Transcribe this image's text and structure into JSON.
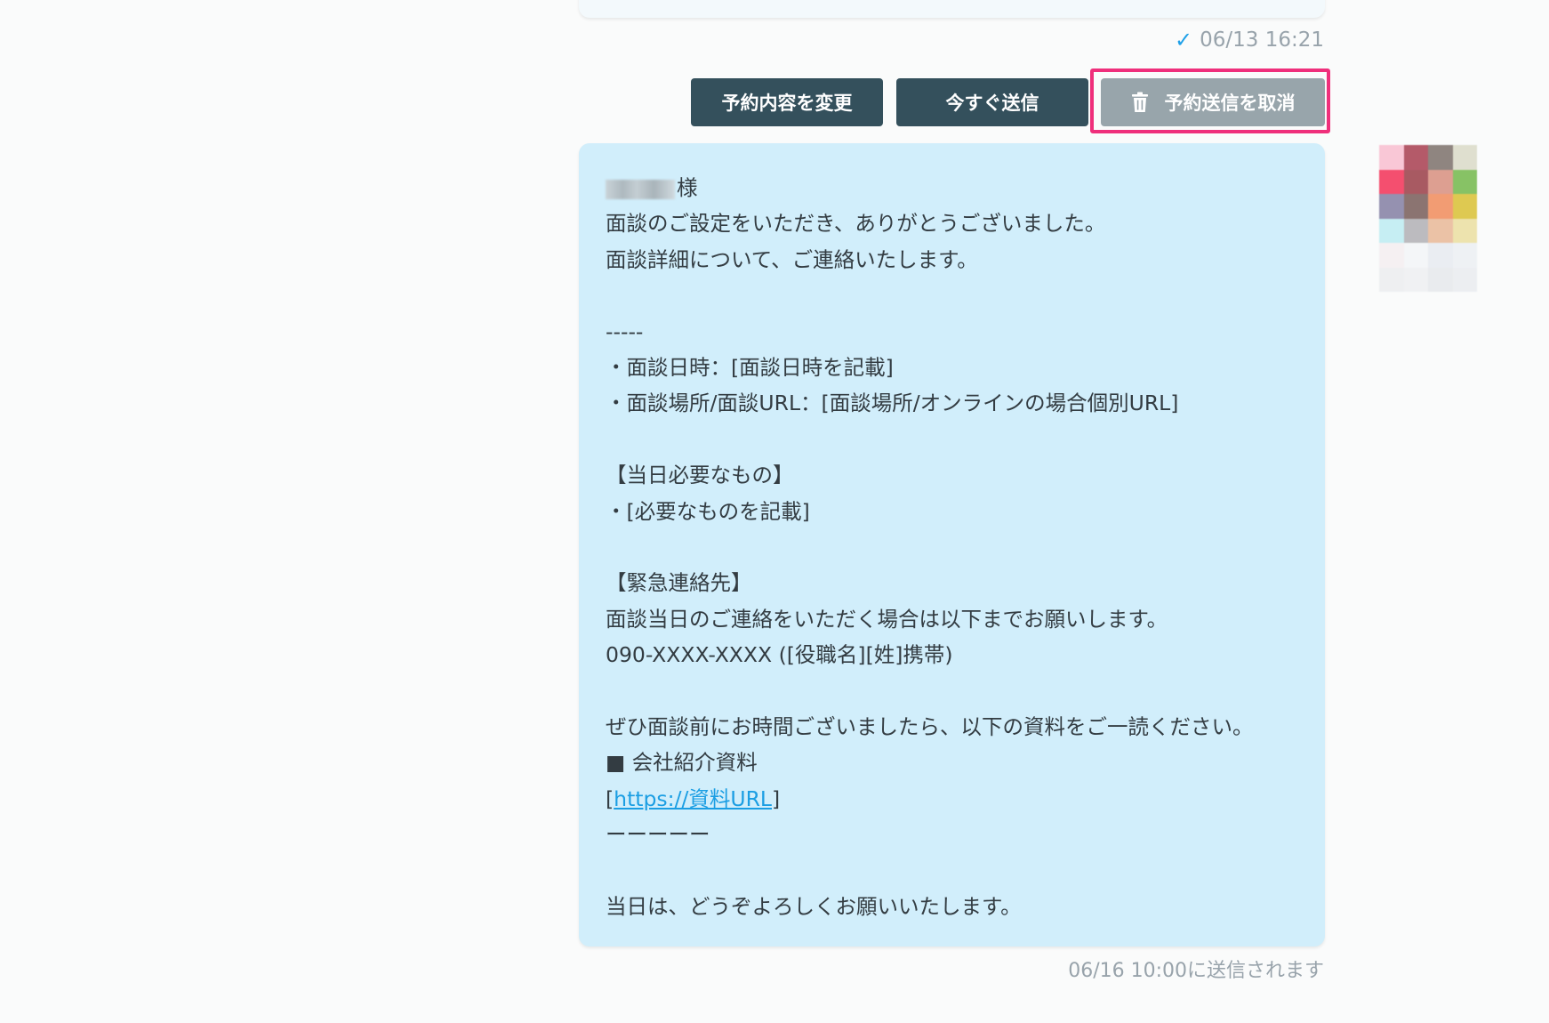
{
  "read_status": {
    "icon": "checkmark-icon",
    "timestamp": "06/13 16:21"
  },
  "actions": {
    "change_label": "予約内容を変更",
    "send_now_label": "今すぐ送信",
    "cancel_label": "予約送信を取消"
  },
  "message": {
    "recipient_suffix": "様",
    "lines": {
      "l1": "面談のご設定をいただき、ありがとうございました。",
      "l2": "面談詳細について、ご連絡いたします。",
      "l3": "-----",
      "l4": "・面談日時：[面談日時を記載]",
      "l5": "・面談場所/面談URL：[面談場所/オンラインの場合個別URL]",
      "l6": "【当日必要なもの】",
      "l7": "・[必要なものを記載]",
      "l8": "【緊急連絡先】",
      "l9": "面談当日のご連絡をいただく場合は以下までお願いします。",
      "l10": "090-XXXX-XXXX ([役職名][姓]携帯)",
      "l11": "ぜひ面談前にお時間ございましたら、以下の資料をご一読ください。",
      "l12": "■ 会社紹介資料",
      "link_open": "[",
      "link_text": "https://資料URL",
      "link_close": "]",
      "l14": "ーーーーー",
      "l15": "当日は、どうぞよろしくお願いいたします。"
    }
  },
  "scheduled_note": "06/16 10:00に送信されます",
  "colors": {
    "button": "#34505c",
    "button_disabled": "#98a5ab",
    "highlight": "#ef2f7b",
    "bubble": "#d1eefb",
    "link": "#1b9ee3",
    "check": "#1ea0e8"
  }
}
